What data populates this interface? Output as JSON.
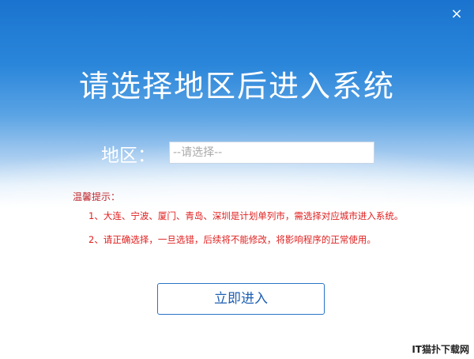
{
  "window": {
    "close_glyph": "×",
    "close_icon": "close-icon"
  },
  "main": {
    "title": "请选择地区后进入系统",
    "region_label": "地区：",
    "region_placeholder": "--请选择--",
    "tips_title": "温馨提示：",
    "tip1": "1、大连、宁波、厦门、青岛、深圳是计划单列市，需选择对应城市进入系统。",
    "tip2": "2、请正确选择，一旦选错，后续将不能修改，将影响程序的正常使用。",
    "enter_button": "立即进入"
  },
  "watermark": "IT猫扑下载网",
  "colors": {
    "brand_blue": "#1a74cf",
    "warning_red": "#e02020",
    "button_text": "#1e5fb3"
  }
}
